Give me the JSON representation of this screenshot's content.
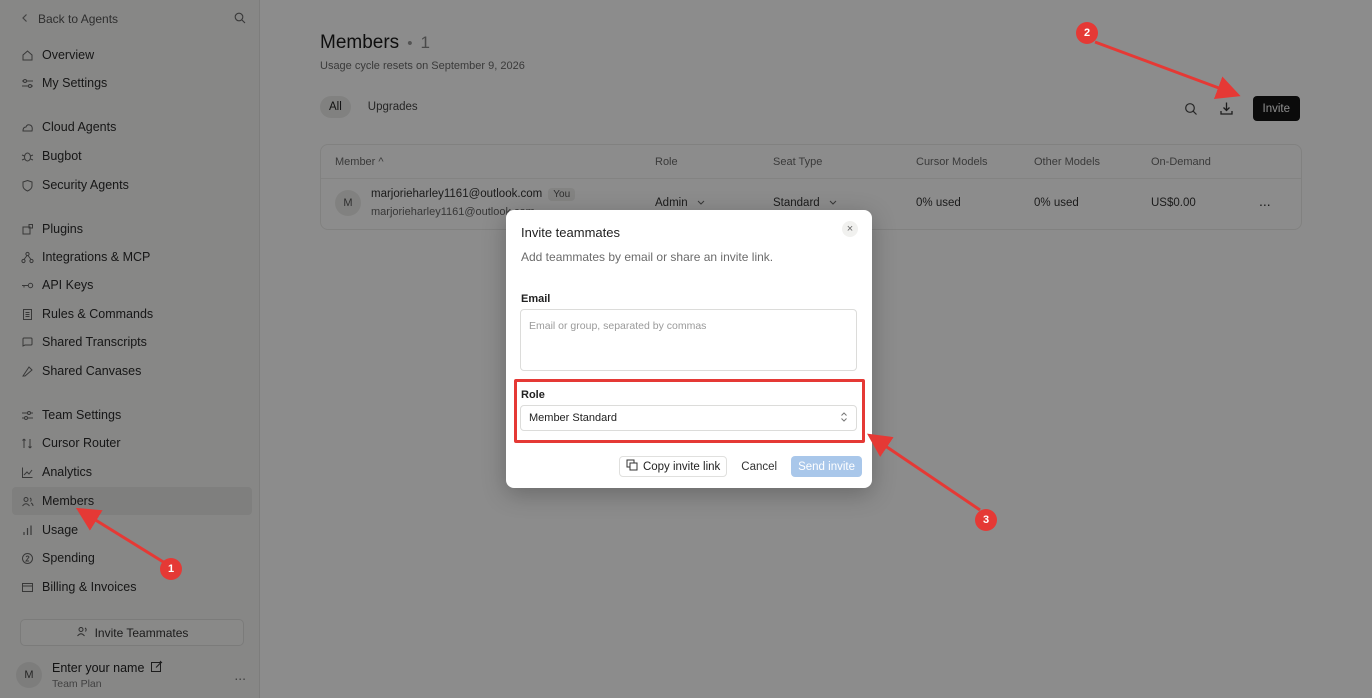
{
  "sidebar": {
    "back_label": "Back to Agents",
    "items": [
      {
        "label": "Overview",
        "icon": "home-icon"
      },
      {
        "label": "My Settings",
        "icon": "sliders-icon"
      },
      {
        "label": "Cloud Agents",
        "icon": "cloud-icon"
      },
      {
        "label": "Bugbot",
        "icon": "bug-icon"
      },
      {
        "label": "Security Agents",
        "icon": "shield-icon"
      },
      {
        "label": "Plugins",
        "icon": "plugin-icon"
      },
      {
        "label": "Integrations & MCP",
        "icon": "integrations-icon"
      },
      {
        "label": "API Keys",
        "icon": "key-icon"
      },
      {
        "label": "Rules & Commands",
        "icon": "rules-icon"
      },
      {
        "label": "Shared Transcripts",
        "icon": "transcripts-icon"
      },
      {
        "label": "Shared Canvases",
        "icon": "canvas-icon"
      },
      {
        "label": "Team Settings",
        "icon": "team-settings-icon"
      },
      {
        "label": "Cursor Router",
        "icon": "router-icon"
      },
      {
        "label": "Analytics",
        "icon": "analytics-icon"
      },
      {
        "label": "Members",
        "icon": "members-icon"
      },
      {
        "label": "Usage",
        "icon": "usage-icon"
      },
      {
        "label": "Spending",
        "icon": "spending-icon"
      },
      {
        "label": "Billing & Invoices",
        "icon": "billing-icon"
      }
    ],
    "invite_teammates_label": "Invite Teammates",
    "user": {
      "avatar": "M",
      "name": "Enter your name",
      "plan": "Team Plan",
      "more": "..."
    }
  },
  "main": {
    "title": "Members",
    "title_dot": "•",
    "member_count": "1",
    "subtitle": "Usage cycle resets on September 9, 2026",
    "tabs": [
      {
        "label": "All"
      },
      {
        "label": "Upgrades"
      }
    ],
    "invite_label": "Invite",
    "table": {
      "columns": [
        "Member ^",
        "Role",
        "Seat Type",
        "Cursor Models",
        "Other Models",
        "On-Demand"
      ],
      "rows": [
        {
          "avatar": "M",
          "email": "marjorieharley1161@outlook.com",
          "you_badge": "You",
          "email_secondary": "marjorieharley1161@outlook.com",
          "role": "Admin",
          "seat_type": "Standard",
          "cursor_models": "0% used",
          "other_models": "0% used",
          "on_demand": "US$0.00",
          "more": "..."
        }
      ]
    }
  },
  "modal": {
    "title": "Invite teammates",
    "description": "Add teammates by email or share an invite link.",
    "email_label": "Email",
    "email_value": "",
    "email_placeholder": "Email or group, separated by commas",
    "role_label": "Role",
    "role_value": "Member Standard",
    "copy_link_label": "Copy invite link",
    "cancel_label": "Cancel",
    "send_label": "Send invite",
    "close": "×"
  },
  "annotations": {
    "badges": [
      "1",
      "2",
      "3"
    ],
    "color": "#e53935"
  }
}
